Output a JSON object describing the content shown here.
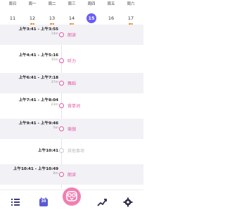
{
  "week": {
    "days": [
      {
        "name": "周日",
        "num": "11",
        "gift": false,
        "selected": false
      },
      {
        "name": "周一",
        "num": "12",
        "gift": true,
        "selected": false
      },
      {
        "name": "周二",
        "num": "13",
        "gift": true,
        "selected": false
      },
      {
        "name": "周三",
        "num": "14",
        "gift": true,
        "selected": false
      },
      {
        "name": "周四",
        "num": "15",
        "gift": false,
        "selected": true
      },
      {
        "name": "周五",
        "num": "16",
        "gift": false,
        "selected": false
      },
      {
        "name": "周六",
        "num": "17",
        "gift": true,
        "selected": false
      }
    ]
  },
  "timeline": {
    "entries": [
      {
        "time": "上午3:41 - 上午3:55",
        "duration": "14m",
        "label": "朗读",
        "gray": false,
        "shaded": true
      },
      {
        "time": "上午4:41 - 上午5:16",
        "duration": "35m",
        "label": "听力",
        "gray": false,
        "shaded": false
      },
      {
        "time": "上午6:41 - 上午7:18",
        "duration": "37m",
        "label": "舞蹈",
        "gray": false,
        "shaded": true
      },
      {
        "time": "上午7:41 - 上午8:04",
        "duration": "23m",
        "label": "背单词",
        "gray": false,
        "shaded": false
      },
      {
        "time": "上午9:41 - 上午9:46",
        "duration": "5m",
        "label": "瑜伽",
        "gray": false,
        "shaded": true
      },
      {
        "time": "上午10:41",
        "duration": "",
        "label": "其他事项",
        "gray": true,
        "shaded": false
      },
      {
        "time": "上午10:41 - 上午10:49",
        "duration": "8m",
        "label": "朗读",
        "gray": false,
        "shaded": true
      }
    ]
  },
  "colors": {
    "accent_pink": "#e0579f",
    "selected_purple": "#6a5cf6",
    "gift_orange": "#f08a2c"
  },
  "tabbar": {
    "icons": [
      "list-icon",
      "calendar-icon",
      "owl-icon",
      "chart-icon",
      "settings-icon"
    ],
    "calendar_num": "30"
  }
}
